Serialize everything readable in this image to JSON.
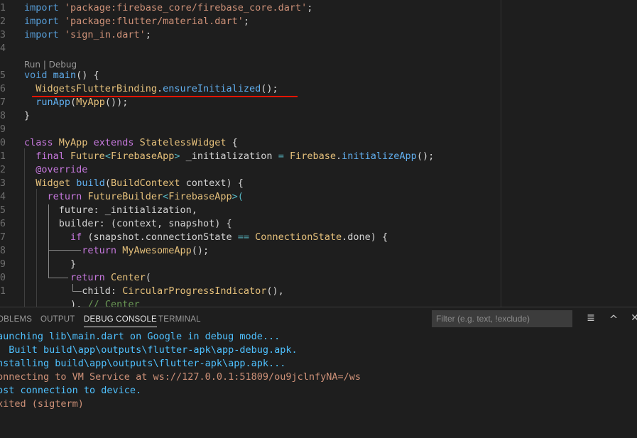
{
  "editor": {
    "codelens": "Run | Debug",
    "line_numbers": [
      "1",
      "2",
      "3",
      "4",
      "5",
      "6",
      "7",
      "8",
      "9",
      "0",
      "1",
      "2",
      "3",
      "4",
      "5",
      "6",
      "7",
      "8",
      "9",
      "0",
      "1"
    ],
    "code": {
      "l1_import": "import",
      "l1_str": "'package:firebase_core/firebase_core.dart'",
      "l1_end": ";",
      "l2_import": "import",
      "l2_str": "'package:flutter/material.dart'",
      "l2_end": ";",
      "l3_import": "import",
      "l3_str": "'sign_in.dart'",
      "l3_end": ";",
      "l5_void": "void",
      "l5_main": "main",
      "l5_rest": "() {",
      "l6_cls": "WidgetsFlutterBinding",
      "l6_dot": ".",
      "l6_method": "ensureInitialized",
      "l6_end": "();",
      "l7_run": "runApp",
      "l7_p1": "(",
      "l7_myapp": "MyApp",
      "l7_end": "());",
      "l8": "}",
      "l10_class": "class",
      "l10_name": "MyApp",
      "l10_extends": "extends",
      "l10_super": "StatelessWidget",
      "l10_brace": " {",
      "l11_final": "final",
      "l11_future": "Future",
      "l11_lt": "<",
      "l11_fa": "FirebaseApp",
      "l11_gt": ">",
      "l11_var": " _initialization ",
      "l11_eq": "=",
      "l11_fb": "Firebase",
      "l11_dot": ".",
      "l11_init": "initializeApp",
      "l11_end": "();",
      "l12_at": "@",
      "l12_override": "override",
      "l13_widget": "Widget",
      "l13_build": "build",
      "l13_p": "(",
      "l13_bc": "BuildContext",
      "l13_rest": " context) {",
      "l14_return": "return",
      "l14_fb": "FutureBuilder",
      "l14_lt": "<",
      "l14_fa": "FirebaseApp",
      "l14_gt": ">(",
      "l15": "future: _initialization,",
      "l16": "builder: (context, snapshot) {",
      "l17_if": "if",
      "l17_a": " (snapshot.connectionState ",
      "l17_eq": "==",
      "l17_cs": "ConnectionState",
      "l17_rest": ".done) {",
      "l18_return": "return",
      "l18_app": "MyAwesomeApp",
      "l18_end": "();",
      "l19": "}",
      "l20_return": "return",
      "l20_center": "Center",
      "l20_p": "(",
      "l21_child": "child: ",
      "l21_cpi": "CircularProgressIndicator",
      "l21_end": "(),",
      "l22_close": "),",
      "l22_comment": "// Center"
    }
  },
  "panel": {
    "tabs": [
      "PROBLEMS",
      "OUTPUT",
      "DEBUG CONSOLE",
      "TERMINAL"
    ],
    "tab_visible": [
      "OBLEMS",
      "OUTPUT",
      "DEBUG CONSOLE",
      "TERMINAL"
    ],
    "active_tab": "DEBUG CONSOLE",
    "filter_placeholder": "Filter (e.g. text, !exclude)",
    "icons": [
      "clear-console-icon",
      "maximize-panel-icon",
      "close-panel-icon"
    ],
    "icon_glyphs": [
      "≣",
      "^",
      "✕"
    ],
    "output_lines": [
      {
        "text": "aunching lib\\main.dart on Google in debug mode...",
        "color": "#4fc1ff"
      },
      {
        "text": "  Built build\\app\\outputs\\flutter-apk\\app-debug.apk.",
        "color": "#4fc1ff"
      },
      {
        "text": "nstalling build\\app\\outputs\\flutter-apk\\app.apk...",
        "color": "#4fc1ff"
      },
      {
        "text": "onnecting to VM Service at ws://127.0.0.1:51809/ou9jclnfyNA=/ws",
        "color": "#ce9178"
      },
      {
        "text": "ost connection to device.",
        "color": "#4fc1ff"
      },
      {
        "text": "xited (sigterm)",
        "color": "#ce9178"
      }
    ]
  },
  "colors": {
    "background": "#1e1e1e",
    "keyword": "#c586c0",
    "string": "#ce9178",
    "function": "#dcdcaa",
    "type": "#e5c07b",
    "error_underline": "#e51400",
    "console_info": "#4fc1ff",
    "console_warn": "#ce9178"
  }
}
